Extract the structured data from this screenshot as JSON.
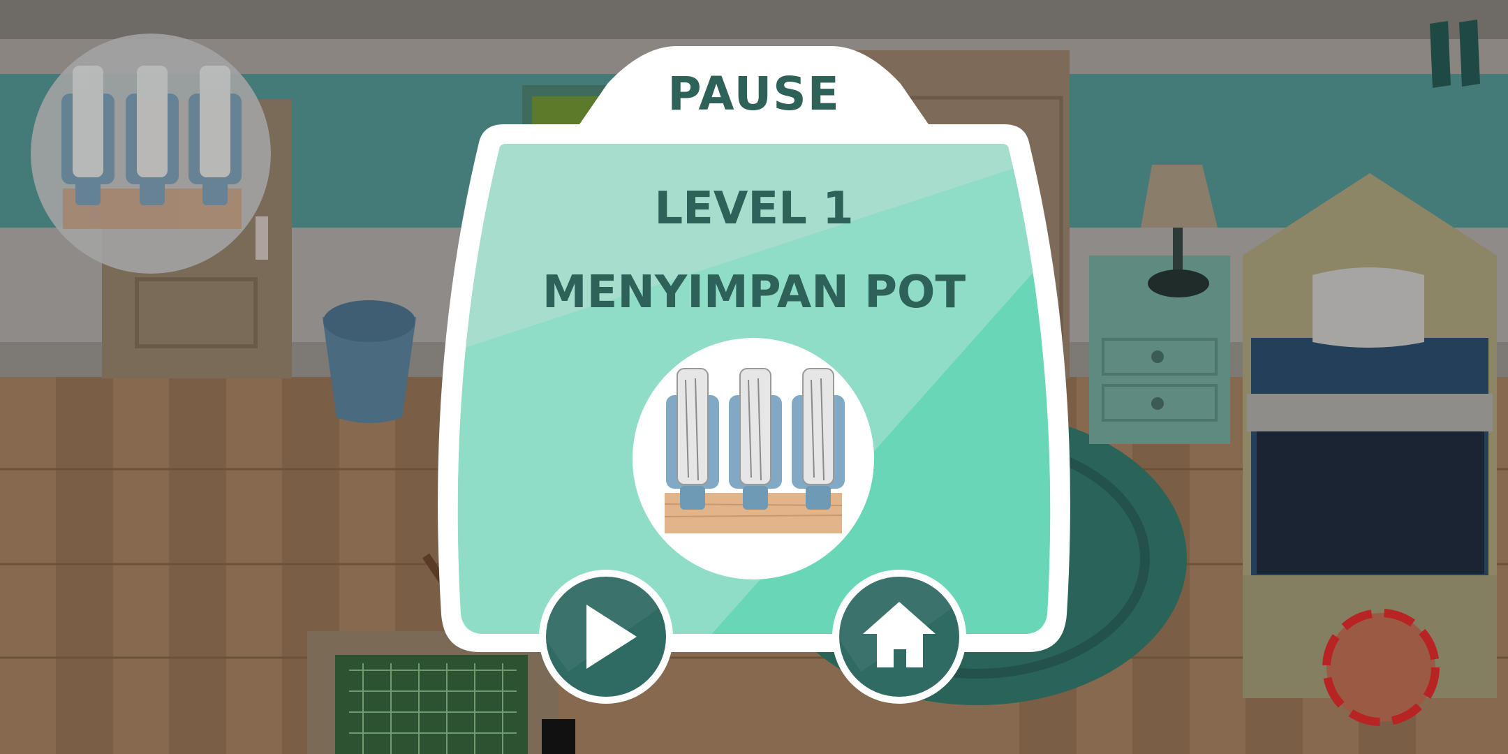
{
  "popup": {
    "title": "PAUSE",
    "level_label": "LEVEL 1",
    "level_name": "MENYIMPAN POT",
    "item_icon": "bottle-planter-icon"
  },
  "controls": {
    "play_icon": "play-icon",
    "home_icon": "home-icon",
    "pause_icon": "pause-icon",
    "alarm_icon": "dashed-circle-indicator-icon"
  },
  "colors": {
    "popup_teal": "#8fdcc7",
    "title_text": "#2e6158",
    "button_fill": "#2f6b63",
    "wall_teal": "#447a77",
    "floor_wood": "#8a6e52",
    "alarm_red": "#c12b2b"
  }
}
